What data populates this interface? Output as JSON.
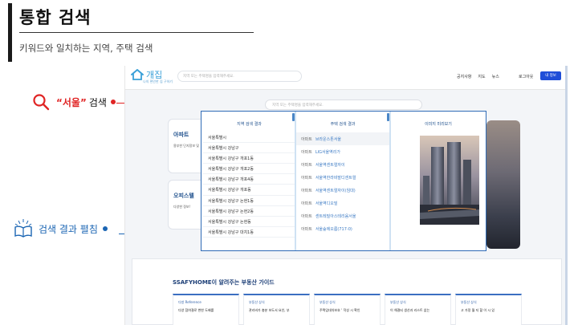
{
  "slide": {
    "title": "통합 검색",
    "subtitle": "키워드와 일치하는 지역, 주택 검색"
  },
  "annotations": {
    "search": {
      "quoted": "“서울”",
      "text": "검색"
    },
    "expand": {
      "text": "검색 결과 펼침"
    }
  },
  "app": {
    "logo": {
      "name": "개집",
      "tagline": "나의 편안한 집 구하기"
    },
    "nav_search_placeholder": "지역 또는 주택명을 입력해주세요.",
    "nav_links": [
      "공지사항",
      "지도",
      "뉴스"
    ],
    "login_label": "로그아웃",
    "myinfo_label": "내 정보",
    "main_search_placeholder": "지역 또는 주택명을 입력해주세요.",
    "cards": [
      {
        "title": "아파트",
        "desc": "용부한 단지정보 및"
      },
      {
        "title": "오피스텔",
        "desc": "다양한 정보!"
      }
    ],
    "dropdown": {
      "region_title": "지역 검색 결과",
      "house_title": "주택 검색 결과",
      "image_title": "이미지 미리보기",
      "regions": [
        "서울특별시",
        "서울특별시 강남구",
        "서울특별시 강남구 개포1동",
        "서울특별시 강남구 개포2동",
        "서울특별시 강남구 개포4동",
        "서울특별시 강남구 개포동",
        "서울특별시 강남구 논현1동",
        "서울특별시 강남구 논현2동",
        "서울특별시 강남구 논현동",
        "서울특별시 강남구 대치1동"
      ],
      "houses": [
        {
          "type": "아파트",
          "name": "브라운스톤서울"
        },
        {
          "type": "아파트",
          "name": "LIG서울역리가"
        },
        {
          "type": "아파트",
          "name": "서울역센트럴자이"
        },
        {
          "type": "아파트",
          "name": "서울역한라비발디센트럴"
        },
        {
          "type": "아파트",
          "name": "서울역센트럴자이(임대)"
        },
        {
          "type": "아파트",
          "name": "서울역디오빌"
        },
        {
          "type": "아파트",
          "name": "센트레빌아스테리움서울"
        },
        {
          "type": "아파트",
          "name": "서울숲에오름(717-0)"
        }
      ]
    },
    "guide": {
      "title": "SSAFYHOME이 알려주는 부동산 가이드",
      "cards": [
        {
          "tag": "다방 Reference",
          "text": "다양 참여결로 변한 도배를"
        },
        {
          "tag": "부동산 상식",
          "text": "관리비가 충분 보도서 요인, 부"
        },
        {
          "tag": "부동산 상식",
          "text": "주택임대차보호 ‘ 작성 시 확인"
        },
        {
          "tag": "부동산 상식",
          "text": "이 해결되 생산과 리스트 없는"
        },
        {
          "tag": "부동산 상식",
          "text": "고 가정 월 지 할 이 시 있"
        }
      ]
    }
  },
  "colors": {
    "accent_red": "#e02424",
    "accent_blue": "#1b65b3",
    "primary_button": "#1f4ed8",
    "panel_border": "#2f6bb6"
  }
}
